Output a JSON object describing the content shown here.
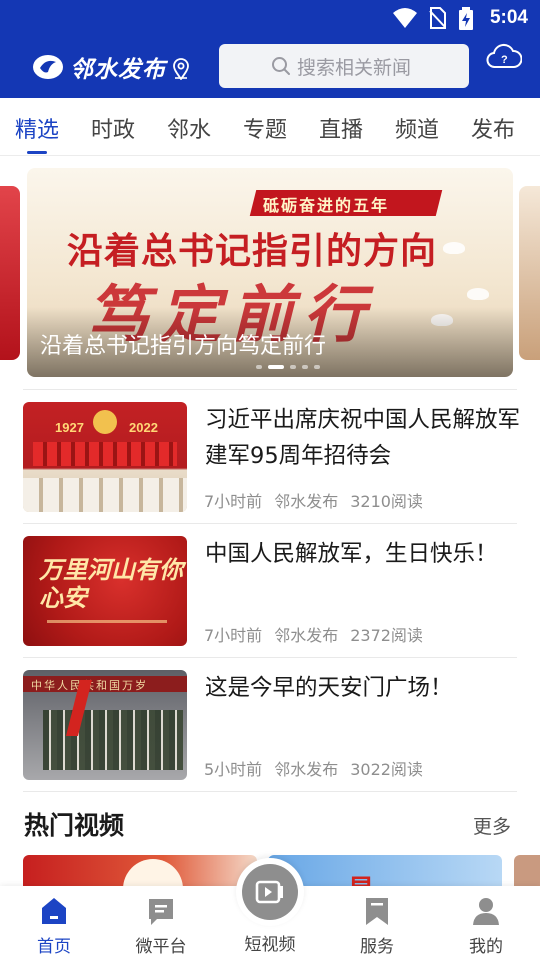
{
  "status_bar": {
    "time": "5:04"
  },
  "header": {
    "brand": "邻水发布",
    "search_placeholder": "搜索相关新闻"
  },
  "tabs": [
    "精选",
    "时政",
    "邻水",
    "专题",
    "直播",
    "频道",
    "发布"
  ],
  "active_tab": "精选",
  "banner": {
    "caption": "沿着总书记指引方向笃定前行",
    "ribbon": "砥砺奋进的五年",
    "headline": "沿着总书记指引的方向",
    "brush": "笃定前行",
    "active_slide": 1,
    "slide_count": 5
  },
  "news": [
    {
      "title": "习近平出席庆祝中国人民解放军建军95周年招待会",
      "time": "7小时前",
      "source": "邻水发布",
      "reads": "3210阅读",
      "thumb_years": [
        "1927",
        "2022"
      ]
    },
    {
      "title": "中国人民解放军，生日快乐！",
      "time": "7小时前",
      "source": "邻水发布",
      "reads": "2372阅读",
      "thumb_text": "万里河山有你心安"
    },
    {
      "title": "这是今早的天安门广场！",
      "time": "5小时前",
      "source": "邻水发布",
      "reads": "3022阅读",
      "thumb_text": "中华人民共和国万岁"
    }
  ],
  "hot_video": {
    "title": "热门视频",
    "more": "更多",
    "v2_glyph": "星"
  },
  "bottom_nav": {
    "items": [
      "首页",
      "微平台",
      "短视频",
      "服务",
      "我的"
    ],
    "active": "首页"
  },
  "colors": {
    "primary": "#1437b4",
    "accent": "#1c44c4",
    "text": "#1a1a1a",
    "meta": "#8e8e8e"
  }
}
